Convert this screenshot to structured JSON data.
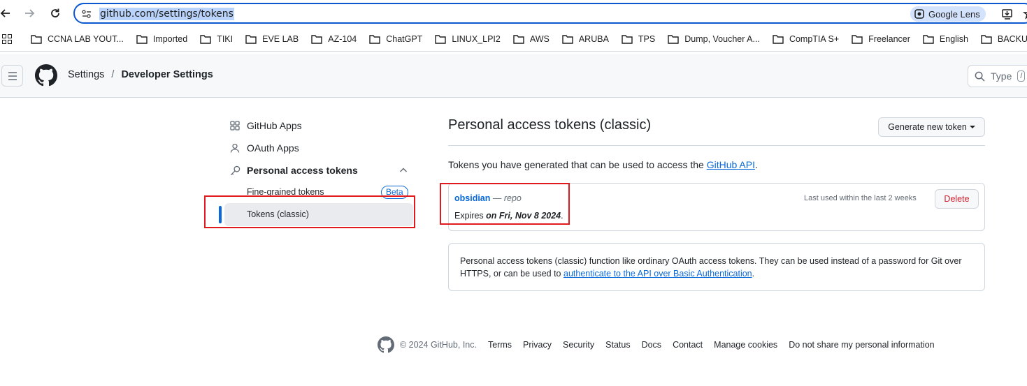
{
  "browser": {
    "url": "github.com/settings/tokens",
    "lens_label": "Google Lens"
  },
  "bookmarks": [
    {
      "label": "CCNA LAB YOUT..."
    },
    {
      "label": "Imported"
    },
    {
      "label": "TIKI"
    },
    {
      "label": "EVE LAB"
    },
    {
      "label": "AZ-104"
    },
    {
      "label": "ChatGPT"
    },
    {
      "label": "LINUX_LPI2"
    },
    {
      "label": "AWS"
    },
    {
      "label": "ARUBA"
    },
    {
      "label": "TPS"
    },
    {
      "label": "Dump, Voucher A..."
    },
    {
      "label": "CompTIA S+"
    },
    {
      "label": "Freelancer"
    },
    {
      "label": "English"
    },
    {
      "label": "BACKU"
    }
  ],
  "header": {
    "crumb_settings": "Settings",
    "crumb_separator": "/",
    "crumb_developer": "Developer Settings",
    "search_label": "Type",
    "search_kbd": "/"
  },
  "sidebar": {
    "github_apps": "GitHub Apps",
    "oauth_apps": "OAuth Apps",
    "pat": "Personal access tokens",
    "fine_grained": "Fine-grained tokens",
    "beta": "Beta",
    "tokens_classic": "Tokens (classic)"
  },
  "main": {
    "title": "Personal access tokens (classic)",
    "generate_label": "Generate new token",
    "intro_text": "Tokens you have generated that can be used to access the ",
    "intro_link": "GitHub API",
    "intro_end": ".",
    "token": {
      "name": "obsidian",
      "dash": " — ",
      "scope": "repo",
      "expires_prefix": "Expires ",
      "expires_date": "on Fri, Nov 8 2024",
      "expires_end": ".",
      "last_used": "Last used within the last 2 weeks",
      "delete_label": "Delete"
    },
    "info_text": "Personal access tokens (classic) function like ordinary OAuth access tokens. They can be used instead of a password for Git over HTTPS, or can be used to ",
    "info_link": "authenticate to the API over Basic Authentication",
    "info_end": "."
  },
  "footer": {
    "copyright": "© 2024 GitHub, Inc.",
    "links": [
      "Terms",
      "Privacy",
      "Security",
      "Status",
      "Docs",
      "Contact",
      "Manage cookies",
      "Do not share my personal information"
    ]
  },
  "colors": {
    "accent": "#0969da",
    "danger": "#cf222e",
    "annotation": "#e0191d"
  }
}
